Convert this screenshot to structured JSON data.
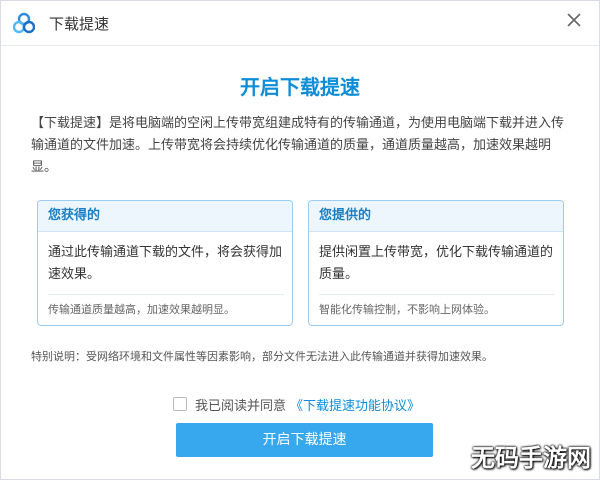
{
  "window": {
    "title": "下载提速",
    "logo_icon": "cloud-logo-icon",
    "close_icon": "close-icon"
  },
  "main": {
    "heading": "开启下载提速",
    "description": "【下载提速】是将电脑端的空闲上传带宽组建成特有的传输通道，为使用电脑端下载并进入传输通道的文件加速。上传带宽将会持续优化传输通道的质量，通道质量越高，加速效果越明显。"
  },
  "cards": {
    "left": {
      "title": "您获得的",
      "main": "通过此传输通道下载的文件，将会获得加速效果。",
      "note": "传输通道质量越高，加速效果越明显。"
    },
    "right": {
      "title": "您提供的",
      "main": "提供闲置上传带宽，优化下载传输通道的质量。",
      "note": "智能化传输控制，不影响上网体验。"
    }
  },
  "special_note": "特别说明：受网络环境和文件属性等因素影响，部分文件无法进入此传输通道并获得加速效果。",
  "agreement": {
    "label": "我已阅读并同意",
    "link": "《下载提速功能协议》",
    "checked": false
  },
  "primary_button": "开启下载提速",
  "watermark": "无码手游网",
  "colors": {
    "accent": "#0d8cd7",
    "button": "#37a8ee",
    "card_border": "#9bcdf0",
    "card_header_bg": "#eef6fd"
  }
}
